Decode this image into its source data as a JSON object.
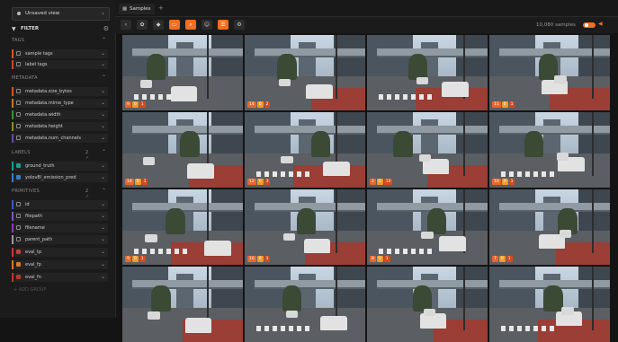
{
  "sidebar": {
    "view_label": "Unsaved view",
    "filter_label": "FILTER",
    "sections": {
      "tags": "TAGS",
      "metadata": "METADATA",
      "labels": "LABELS",
      "labels_extra": "2 ✓",
      "primitives": "PRIMITIVES",
      "primitives_extra": "2 ✓"
    },
    "tags_items": [
      {
        "label": "sample tags",
        "color": "#d6532a"
      },
      {
        "label": "label tags",
        "color": "#c9452b"
      }
    ],
    "metadata_items": [
      {
        "label": "metadata.size_bytes",
        "color": "#d6532a"
      },
      {
        "label": "metadata.mime_type",
        "color": "#c07a2b"
      },
      {
        "label": "metadata.width",
        "color": "#3a8f3a"
      },
      {
        "label": "metadata.height",
        "color": "#8a8a2a"
      },
      {
        "label": "metadata.num_channels",
        "color": "#6a4a9a"
      }
    ],
    "labels_items": [
      {
        "label": "ground_truth",
        "color": "#1a9c8e"
      },
      {
        "label": "yolov8l_emission_pred",
        "color": "#3a7ac8"
      }
    ],
    "primitives_items": [
      {
        "label": "id",
        "color": "#3a5ac8"
      },
      {
        "label": "filepath",
        "color": "#7a5ab8"
      },
      {
        "label": "filename",
        "color": "#8a3ab8"
      },
      {
        "label": "parent_path",
        "color": "#9a9a9a"
      },
      {
        "label": "eval_tp",
        "color": "#c83a3a"
      },
      {
        "label": "eval_fp",
        "color": "#d87a2a"
      },
      {
        "label": "eval_fn",
        "color": "#b83a2a"
      }
    ],
    "add_group": "+ ADD GROUP"
  },
  "tabs": {
    "samples": "Samples",
    "add": "+"
  },
  "toolbar": {
    "count_text": "10,080 samples",
    "icons": [
      "back-icon",
      "color-palette-icon",
      "tag-icon",
      "image-icon",
      "search-icon",
      "person-icon",
      "list-icon",
      "gear-icon"
    ]
  },
  "grid": {
    "tiles": [
      [
        "9",
        "0",
        "1"
      ],
      [
        "14",
        "0",
        "2"
      ],
      [
        "",
        "",
        ""
      ],
      [
        "11",
        "0",
        "1"
      ],
      [
        "14",
        "0",
        "1"
      ],
      [
        "12",
        "0",
        "3"
      ],
      [
        "2",
        "0",
        "10"
      ],
      [
        "10",
        "0",
        "1"
      ],
      [
        "9",
        "0",
        "1"
      ],
      [
        "16",
        "0",
        "1"
      ],
      [
        "8",
        "0",
        "1"
      ],
      [
        "7",
        "0",
        "1"
      ],
      [
        "",
        "",
        ""
      ],
      [
        "",
        "",
        ""
      ],
      [
        "",
        "",
        ""
      ],
      [
        "",
        "",
        ""
      ]
    ]
  },
  "colors": {
    "accent": "#f06f24",
    "teal": "#1a9c8e"
  }
}
